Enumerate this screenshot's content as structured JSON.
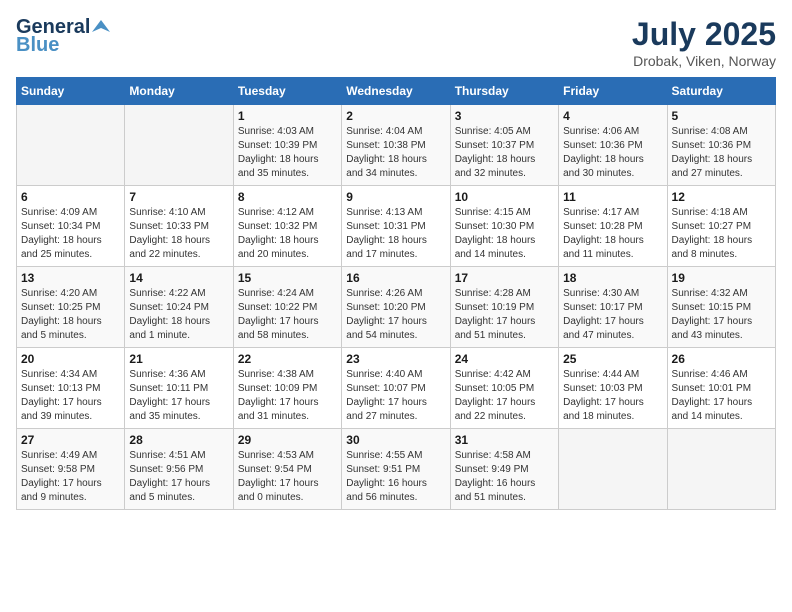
{
  "header": {
    "logo_general": "General",
    "logo_blue": "Blue",
    "title": "July 2025",
    "subtitle": "Drobak, Viken, Norway"
  },
  "days_of_week": [
    "Sunday",
    "Monday",
    "Tuesday",
    "Wednesday",
    "Thursday",
    "Friday",
    "Saturday"
  ],
  "weeks": [
    [
      {
        "day": "",
        "info": ""
      },
      {
        "day": "",
        "info": ""
      },
      {
        "day": "1",
        "info": "Sunrise: 4:03 AM\nSunset: 10:39 PM\nDaylight: 18 hours\nand 35 minutes."
      },
      {
        "day": "2",
        "info": "Sunrise: 4:04 AM\nSunset: 10:38 PM\nDaylight: 18 hours\nand 34 minutes."
      },
      {
        "day": "3",
        "info": "Sunrise: 4:05 AM\nSunset: 10:37 PM\nDaylight: 18 hours\nand 32 minutes."
      },
      {
        "day": "4",
        "info": "Sunrise: 4:06 AM\nSunset: 10:36 PM\nDaylight: 18 hours\nand 30 minutes."
      },
      {
        "day": "5",
        "info": "Sunrise: 4:08 AM\nSunset: 10:36 PM\nDaylight: 18 hours\nand 27 minutes."
      }
    ],
    [
      {
        "day": "6",
        "info": "Sunrise: 4:09 AM\nSunset: 10:34 PM\nDaylight: 18 hours\nand 25 minutes."
      },
      {
        "day": "7",
        "info": "Sunrise: 4:10 AM\nSunset: 10:33 PM\nDaylight: 18 hours\nand 22 minutes."
      },
      {
        "day": "8",
        "info": "Sunrise: 4:12 AM\nSunset: 10:32 PM\nDaylight: 18 hours\nand 20 minutes."
      },
      {
        "day": "9",
        "info": "Sunrise: 4:13 AM\nSunset: 10:31 PM\nDaylight: 18 hours\nand 17 minutes."
      },
      {
        "day": "10",
        "info": "Sunrise: 4:15 AM\nSunset: 10:30 PM\nDaylight: 18 hours\nand 14 minutes."
      },
      {
        "day": "11",
        "info": "Sunrise: 4:17 AM\nSunset: 10:28 PM\nDaylight: 18 hours\nand 11 minutes."
      },
      {
        "day": "12",
        "info": "Sunrise: 4:18 AM\nSunset: 10:27 PM\nDaylight: 18 hours\nand 8 minutes."
      }
    ],
    [
      {
        "day": "13",
        "info": "Sunrise: 4:20 AM\nSunset: 10:25 PM\nDaylight: 18 hours\nand 5 minutes."
      },
      {
        "day": "14",
        "info": "Sunrise: 4:22 AM\nSunset: 10:24 PM\nDaylight: 18 hours\nand 1 minute."
      },
      {
        "day": "15",
        "info": "Sunrise: 4:24 AM\nSunset: 10:22 PM\nDaylight: 17 hours\nand 58 minutes."
      },
      {
        "day": "16",
        "info": "Sunrise: 4:26 AM\nSunset: 10:20 PM\nDaylight: 17 hours\nand 54 minutes."
      },
      {
        "day": "17",
        "info": "Sunrise: 4:28 AM\nSunset: 10:19 PM\nDaylight: 17 hours\nand 51 minutes."
      },
      {
        "day": "18",
        "info": "Sunrise: 4:30 AM\nSunset: 10:17 PM\nDaylight: 17 hours\nand 47 minutes."
      },
      {
        "day": "19",
        "info": "Sunrise: 4:32 AM\nSunset: 10:15 PM\nDaylight: 17 hours\nand 43 minutes."
      }
    ],
    [
      {
        "day": "20",
        "info": "Sunrise: 4:34 AM\nSunset: 10:13 PM\nDaylight: 17 hours\nand 39 minutes."
      },
      {
        "day": "21",
        "info": "Sunrise: 4:36 AM\nSunset: 10:11 PM\nDaylight: 17 hours\nand 35 minutes."
      },
      {
        "day": "22",
        "info": "Sunrise: 4:38 AM\nSunset: 10:09 PM\nDaylight: 17 hours\nand 31 minutes."
      },
      {
        "day": "23",
        "info": "Sunrise: 4:40 AM\nSunset: 10:07 PM\nDaylight: 17 hours\nand 27 minutes."
      },
      {
        "day": "24",
        "info": "Sunrise: 4:42 AM\nSunset: 10:05 PM\nDaylight: 17 hours\nand 22 minutes."
      },
      {
        "day": "25",
        "info": "Sunrise: 4:44 AM\nSunset: 10:03 PM\nDaylight: 17 hours\nand 18 minutes."
      },
      {
        "day": "26",
        "info": "Sunrise: 4:46 AM\nSunset: 10:01 PM\nDaylight: 17 hours\nand 14 minutes."
      }
    ],
    [
      {
        "day": "27",
        "info": "Sunrise: 4:49 AM\nSunset: 9:58 PM\nDaylight: 17 hours\nand 9 minutes."
      },
      {
        "day": "28",
        "info": "Sunrise: 4:51 AM\nSunset: 9:56 PM\nDaylight: 17 hours\nand 5 minutes."
      },
      {
        "day": "29",
        "info": "Sunrise: 4:53 AM\nSunset: 9:54 PM\nDaylight: 17 hours\nand 0 minutes."
      },
      {
        "day": "30",
        "info": "Sunrise: 4:55 AM\nSunset: 9:51 PM\nDaylight: 16 hours\nand 56 minutes."
      },
      {
        "day": "31",
        "info": "Sunrise: 4:58 AM\nSunset: 9:49 PM\nDaylight: 16 hours\nand 51 minutes."
      },
      {
        "day": "",
        "info": ""
      },
      {
        "day": "",
        "info": ""
      }
    ]
  ]
}
